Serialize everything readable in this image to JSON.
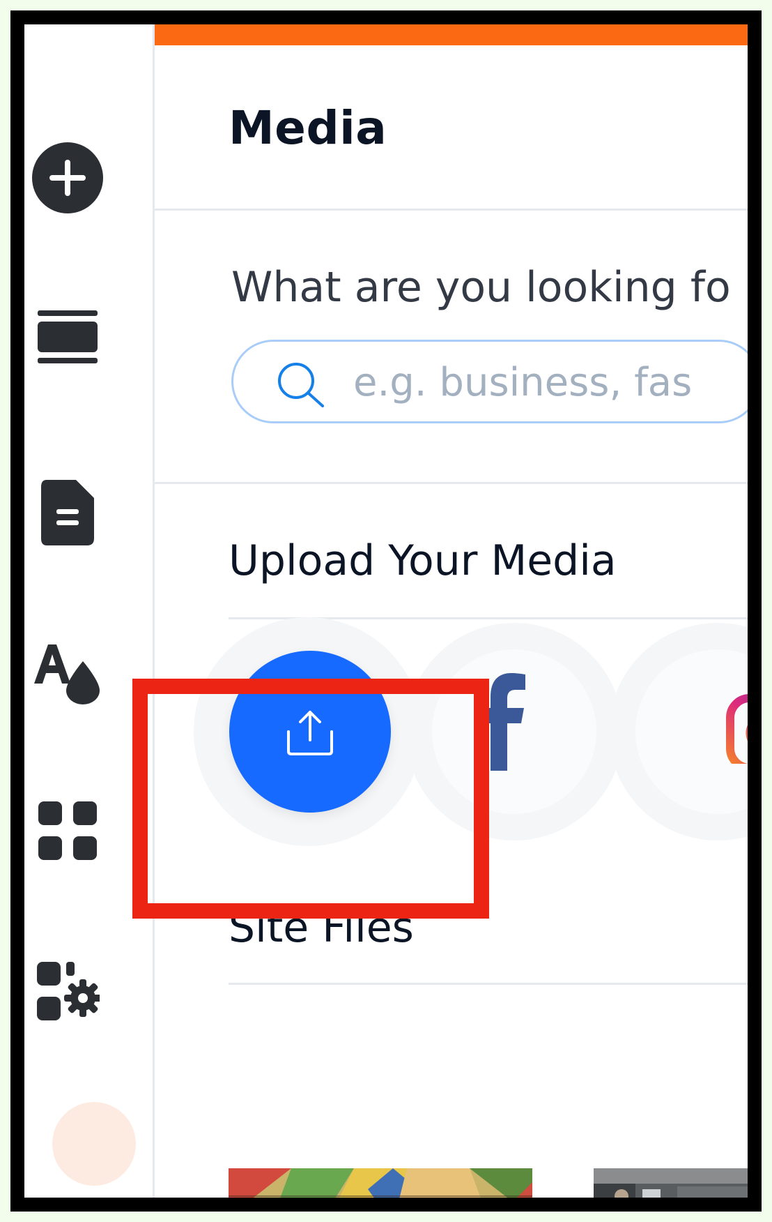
{
  "panel": {
    "title": "Media",
    "accent_color": "#fb6a13"
  },
  "search": {
    "prompt": "What are you looking fo",
    "placeholder": "e.g. business, fas",
    "icon": "search-icon"
  },
  "sections": {
    "upload": "Upload Your Media",
    "site_files": "Site Files"
  },
  "upload_sources": [
    {
      "name": "upload",
      "icon": "upload-icon",
      "color": "#166aff"
    },
    {
      "name": "facebook",
      "icon": "facebook-icon",
      "color": "#3b5998"
    },
    {
      "name": "instagram",
      "icon": "instagram-icon",
      "color": "#e1306c"
    }
  ],
  "sidebar": {
    "items": [
      {
        "icon": "add-icon"
      },
      {
        "icon": "sections-icon"
      },
      {
        "icon": "pages-icon"
      },
      {
        "icon": "theme-icon"
      },
      {
        "icon": "apps-icon"
      },
      {
        "icon": "app-settings-icon"
      }
    ]
  },
  "highlight_color": "#ec2413"
}
